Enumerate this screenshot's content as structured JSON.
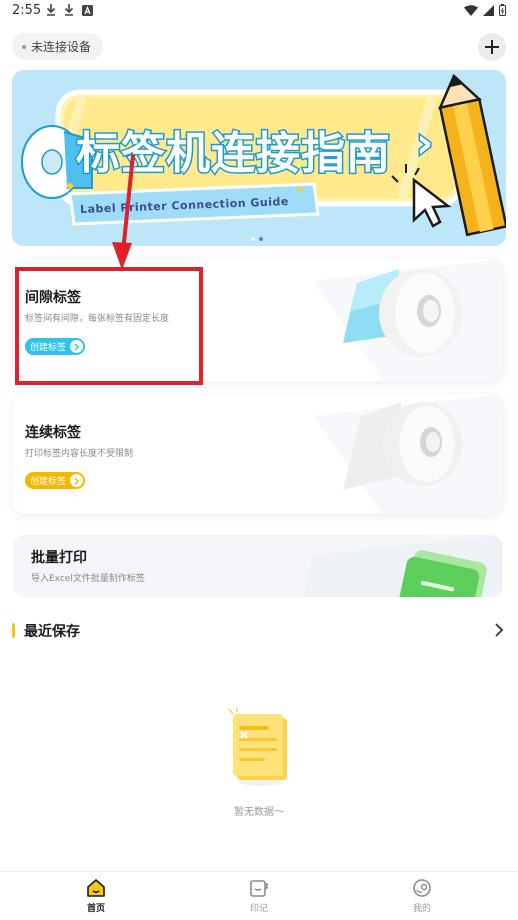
{
  "status_bar": {
    "time": "2:55"
  },
  "header": {
    "device_status": "未连接设备"
  },
  "banner": {
    "title": "标签机连接指南",
    "subtitle": "Label Printer Connection Guide",
    "chevron": "›"
  },
  "cards": [
    {
      "title": "间隙标签",
      "description": "标签间有间隙，每张标签有固定长度",
      "button_label": "创建标签",
      "accent": "#30c3ea"
    },
    {
      "title": "连续标签",
      "description": "打印标签内容长度不受限制",
      "button_label": "创建标签",
      "accent": "#f5b800"
    },
    {
      "title": "批量打印",
      "description": "导入Excel文件批量制作标签"
    }
  ],
  "recent": {
    "title": "最近保存",
    "empty_text": "暂无数据～"
  },
  "bottom_nav": [
    {
      "label": "首页",
      "icon": "home-icon",
      "active": true
    },
    {
      "label": "印记",
      "icon": "notes-icon",
      "active": false
    },
    {
      "label": "我的",
      "icon": "profile-icon",
      "active": false
    }
  ],
  "colors": {
    "highlight": "#e0202c",
    "accent_yellow": "#f5c51a",
    "accent_blue": "#30c3ea",
    "active_nav": "#1b1b1b",
    "inactive_nav": "#9a9a9a"
  }
}
